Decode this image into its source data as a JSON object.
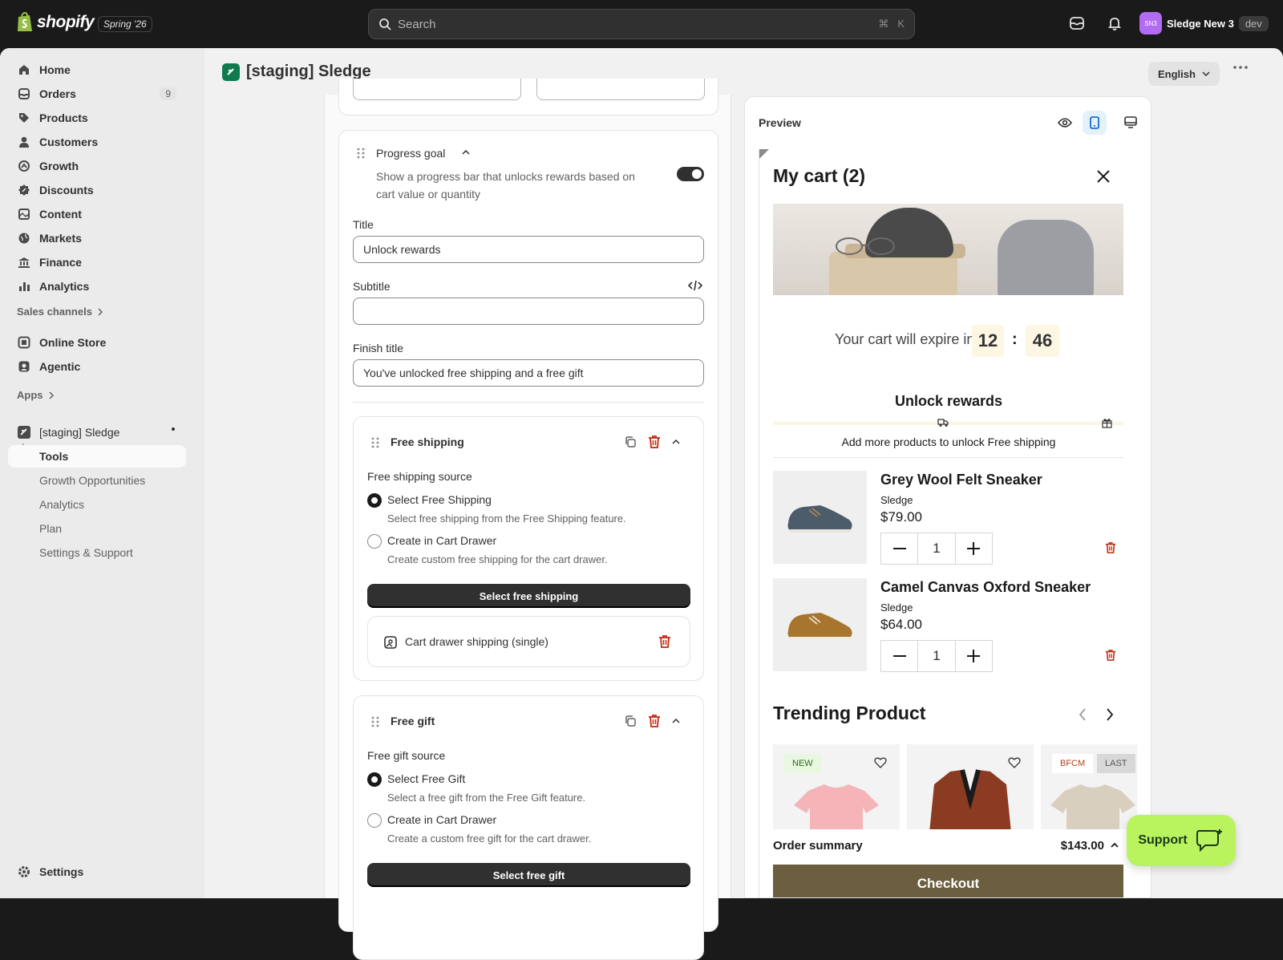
{
  "topbar": {
    "logo_text": "shopify",
    "version_badge": "Spring '26",
    "search_placeholder": "Search",
    "search_shortcut": "⌘   K",
    "store_initials": "SN3",
    "store_name": "Sledge New 3",
    "env_badge": "dev"
  },
  "sidebar": {
    "items": [
      {
        "label": "Home",
        "icon": "home-icon"
      },
      {
        "label": "Orders",
        "icon": "orders-icon",
        "count": "9"
      },
      {
        "label": "Products",
        "icon": "tag-icon"
      },
      {
        "label": "Customers",
        "icon": "person-icon"
      },
      {
        "label": "Growth",
        "icon": "growth-icon"
      },
      {
        "label": "Discounts",
        "icon": "discount-icon"
      },
      {
        "label": "Content",
        "icon": "content-icon"
      },
      {
        "label": "Markets",
        "icon": "globe-icon"
      },
      {
        "label": "Finance",
        "icon": "bank-icon"
      },
      {
        "label": "Analytics",
        "icon": "bar-chart-icon"
      }
    ],
    "sales_channels_label": "Sales channels",
    "channels": [
      {
        "label": "Online Store",
        "icon": "store-icon"
      },
      {
        "label": "Agentic",
        "icon": "agent-icon"
      }
    ],
    "apps_label": "Apps",
    "app_name": "[staging] Sledge",
    "app_subitems": [
      "Tools",
      "Growth Opportunities",
      "Analytics",
      "Plan",
      "Settings & Support"
    ],
    "settings_label": "Settings"
  },
  "header": {
    "title": "[staging] Sledge",
    "language": "English"
  },
  "editor": {
    "progress_goal": {
      "heading": "Progress goal",
      "description_line1": "Show a progress bar that unlocks rewards based on",
      "description_line2": "cart value or quantity",
      "enabled": true,
      "title_label": "Title",
      "title_value": "Unlock rewards",
      "subtitle_label": "Subtitle",
      "subtitle_value": "",
      "finish_title_label": "Finish title",
      "finish_title_value": "You've unlocked free shipping and a free gift"
    },
    "free_shipping": {
      "heading": "Free shipping",
      "source_label": "Free shipping source",
      "option1_label": "Select Free Shipping",
      "option1_help": "Select free shipping from the Free Shipping feature.",
      "option2_label": "Create in Cart Drawer",
      "option2_help": "Create custom free shipping for the cart drawer.",
      "selected": "option1",
      "button_label": "Select free shipping",
      "item_label": "Cart drawer shipping (single)"
    },
    "free_gift": {
      "heading": "Free gift",
      "source_label": "Free gift source",
      "option1_label": "Select Free Gift",
      "option1_help": "Select a free gift from the Free Gift feature.",
      "option2_label": "Create in Cart Drawer",
      "option2_help": "Create a custom free gift for the cart drawer.",
      "selected": "option1",
      "button_label": "Select free gift"
    }
  },
  "preview": {
    "heading": "Preview",
    "cart_title": "My cart (2)",
    "expire_text": "Your cart will expire in",
    "timer_minutes": "12",
    "timer_separator": ":",
    "timer_seconds": "46",
    "goal_title": "Unlock rewards",
    "goal_progress_fraction": 0.0,
    "goal_subtitle": "Add more products to unlock Free shipping",
    "items": [
      {
        "name": "Grey Wool Felt Sneaker",
        "vendor": "Sledge",
        "price": "$79.00",
        "qty": "1"
      },
      {
        "name": "Camel Canvas Oxford Sneaker",
        "vendor": "Sledge",
        "price": "$64.00",
        "qty": "1"
      }
    ],
    "trending_title": "Trending Product",
    "trending_tags": [
      "NEW",
      "BFCM",
      "LAST"
    ],
    "order_summary_label": "Order summary",
    "order_total": "$143.00",
    "checkout_label": "Checkout",
    "accent_color": "#6b5f3f"
  },
  "support": {
    "label": "Support"
  }
}
